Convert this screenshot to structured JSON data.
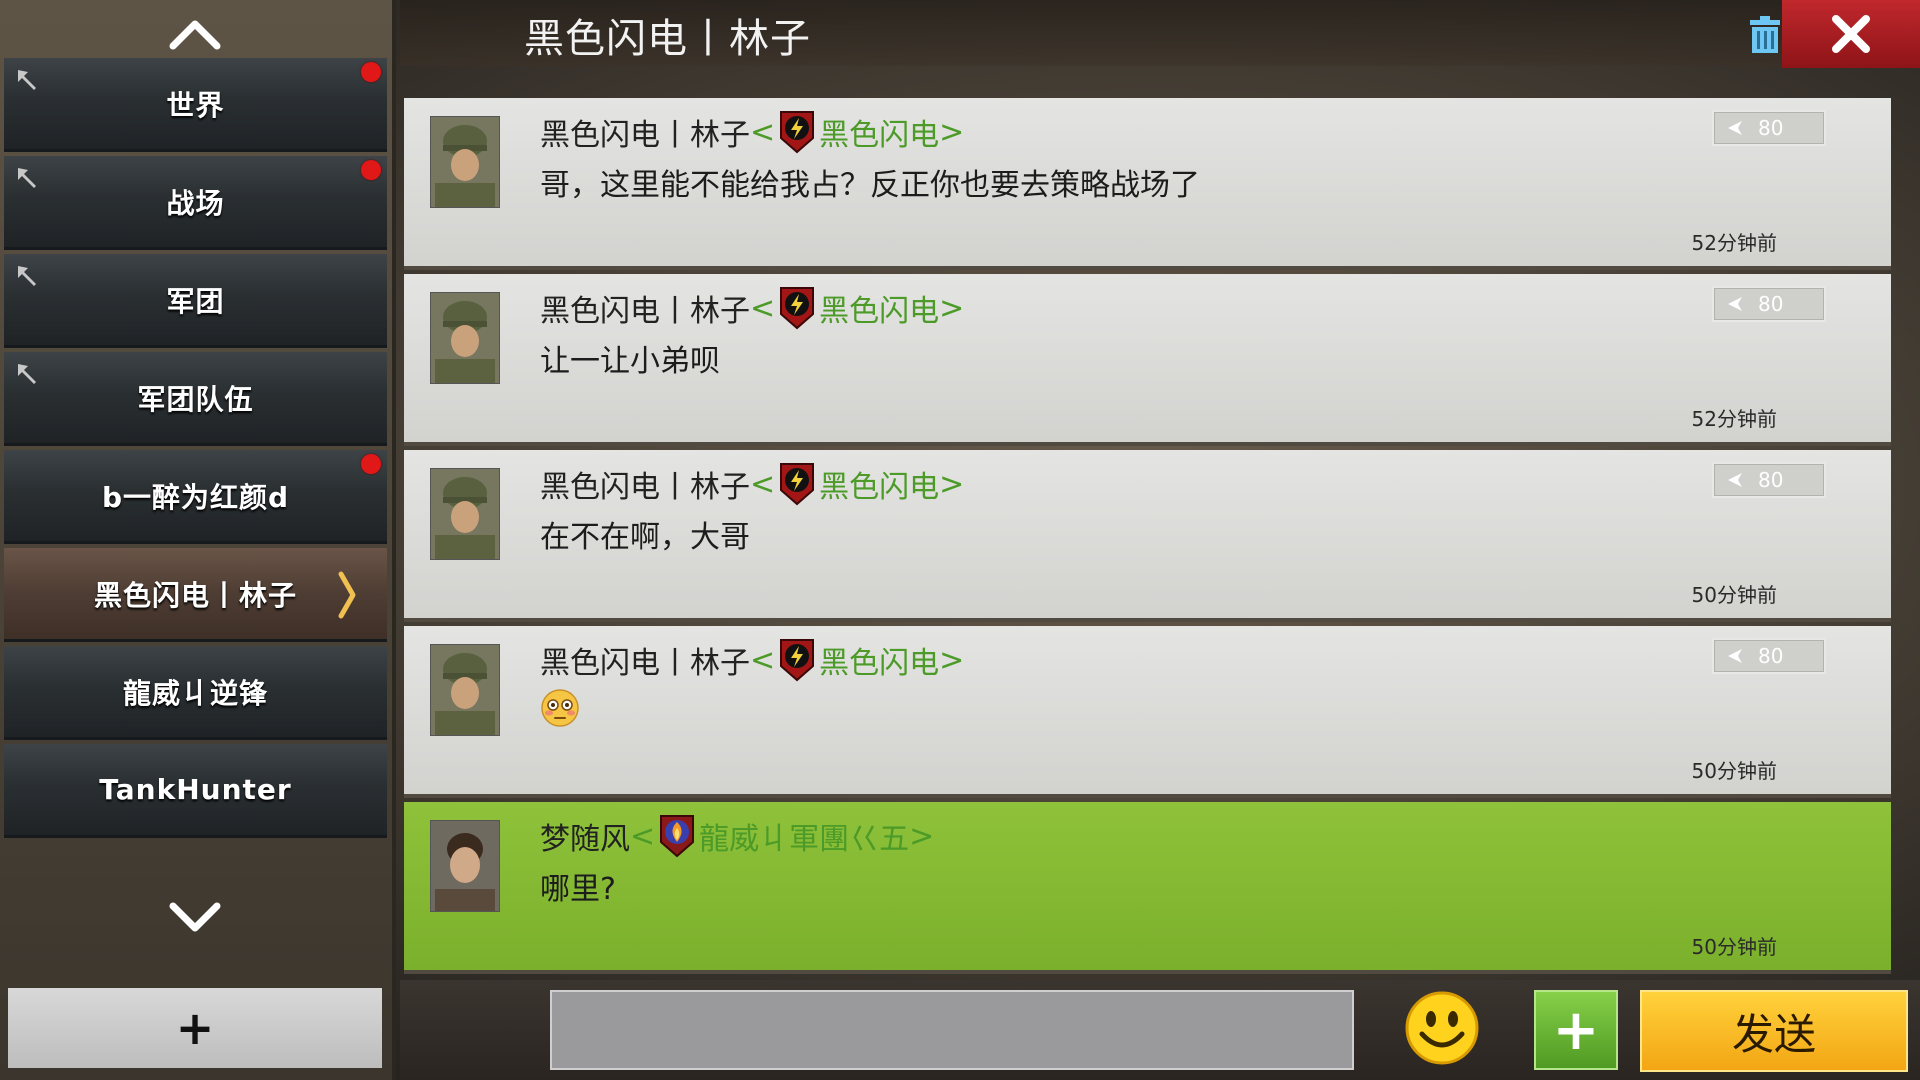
{
  "sidebar": {
    "tabs": [
      {
        "label": "世界",
        "pinned": true,
        "unread": true
      },
      {
        "label": "战场",
        "pinned": true,
        "unread": true
      },
      {
        "label": "军团",
        "pinned": true,
        "unread": false
      },
      {
        "label": "军团队伍",
        "pinned": true,
        "unread": false
      },
      {
        "label": "b一醉为红颜d",
        "pinned": false,
        "unread": true
      },
      {
        "label": "黑色闪电丨林子",
        "pinned": false,
        "unread": false,
        "selected": true
      },
      {
        "label": "龍威丩逆锋",
        "pinned": false,
        "unread": false
      },
      {
        "label": "TankHunter",
        "pinned": false,
        "unread": false
      }
    ],
    "add_label": "+"
  },
  "header": {
    "title": "黑色闪电丨林子"
  },
  "messages": [
    {
      "sender": "黑色闪电丨林子",
      "open": "<",
      "guild": "黑色闪电",
      "close": ">",
      "text": "哥，这里能不能给我占？反正你也要去策略战场了",
      "level": "80",
      "time": "52分钟前"
    },
    {
      "sender": "黑色闪电丨林子",
      "open": "<",
      "guild": "黑色闪电",
      "close": ">",
      "text": "让一让小弟呗",
      "level": "80",
      "time": "52分钟前"
    },
    {
      "sender": "黑色闪电丨林子",
      "open": "<",
      "guild": "黑色闪电",
      "close": ">",
      "text": "在不在啊，大哥",
      "level": "80",
      "time": "50分钟前"
    },
    {
      "sender": "黑色闪电丨林子",
      "open": "<",
      "guild": "黑色闪电",
      "close": ">",
      "text": "",
      "emoji": "flushed-face",
      "level": "80",
      "time": "50分钟前"
    },
    {
      "sender": "梦随风",
      "open": "<",
      "guild": "龍威丩軍團巜五",
      "close": ">",
      "text": "哪里?",
      "time": "50分钟前",
      "mine": true
    }
  ],
  "composer": {
    "input_value": "",
    "plus_label": "+",
    "send_label": "发送"
  },
  "colors": {
    "guild_green": "#4c9a28",
    "own_message_bg": "#8fc23a",
    "unread_dot": "#e01818",
    "send_button": "#f3a614",
    "close_button": "#c0282c"
  }
}
